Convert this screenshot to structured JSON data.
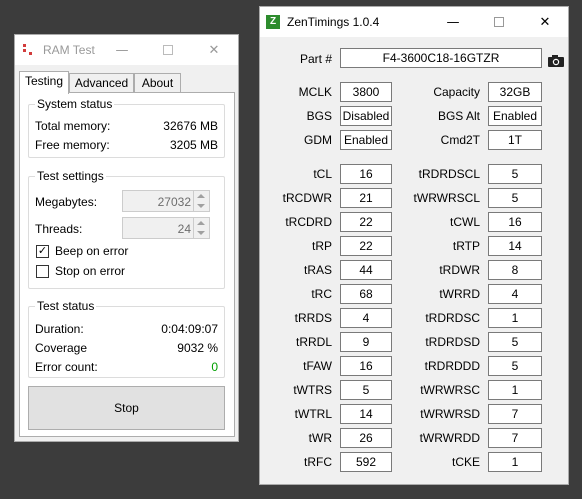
{
  "ramtest": {
    "title": "RAM Test",
    "tabs": [
      "Testing",
      "Advanced",
      "About"
    ],
    "system_status": {
      "label": "System status",
      "total_memory_label": "Total memory:",
      "total_memory_value": "32676 MB",
      "free_memory_label": "Free memory:",
      "free_memory_value": "3205 MB"
    },
    "test_settings": {
      "label": "Test settings",
      "megabytes_label": "Megabytes:",
      "megabytes_value": "27032",
      "threads_label": "Threads:",
      "threads_value": "24",
      "beep_label": "Beep on error",
      "beep_checked": true,
      "stop_label": "Stop on error",
      "stop_checked": false
    },
    "test_status": {
      "label": "Test status",
      "duration_label": "Duration:",
      "duration_value": "0:04:09:07",
      "coverage_label": "Coverage",
      "coverage_value": "9032 %",
      "errors_label": "Error count:",
      "errors_value": "0",
      "errors_color": "#00a000"
    },
    "stop_button": "Stop"
  },
  "zen": {
    "title": "ZenTimings 1.0.4",
    "icon_letter": "Z",
    "part_label": "Part #",
    "part_value": "F4-3600C18-16GTZR",
    "top": [
      {
        "l1": "MCLK",
        "v1": "3800",
        "l2": "Capacity",
        "v2": "32GB"
      },
      {
        "l1": "BGS",
        "v1": "Disabled",
        "l2": "BGS Alt",
        "v2": "Enabled"
      },
      {
        "l1": "GDM",
        "v1": "Enabled",
        "l2": "Cmd2T",
        "v2": "1T"
      }
    ],
    "timings": [
      {
        "l1": "tCL",
        "v1": "16",
        "l2": "tRDRDSCL",
        "v2": "5"
      },
      {
        "l1": "tRCDWR",
        "v1": "21",
        "l2": "tWRWRSCL",
        "v2": "5"
      },
      {
        "l1": "tRCDRD",
        "v1": "22",
        "l2": "tCWL",
        "v2": "16"
      },
      {
        "l1": "tRP",
        "v1": "22",
        "l2": "tRTP",
        "v2": "14"
      },
      {
        "l1": "tRAS",
        "v1": "44",
        "l2": "tRDWR",
        "v2": "8"
      },
      {
        "l1": "tRC",
        "v1": "68",
        "l2": "tWRRD",
        "v2": "4"
      },
      {
        "l1": "tRRDS",
        "v1": "4",
        "l2": "tRDRDSC",
        "v2": "1"
      },
      {
        "l1": "tRRDL",
        "v1": "9",
        "l2": "tRDRDSD",
        "v2": "5"
      },
      {
        "l1": "tFAW",
        "v1": "16",
        "l2": "tRDRDDD",
        "v2": "5"
      },
      {
        "l1": "tWTRS",
        "v1": "5",
        "l2": "tWRWRSC",
        "v2": "1"
      },
      {
        "l1": "tWTRL",
        "v1": "14",
        "l2": "tWRWRSD",
        "v2": "7"
      },
      {
        "l1": "tWR",
        "v1": "26",
        "l2": "tWRWRDD",
        "v2": "7"
      },
      {
        "l1": "tRFC",
        "v1": "592",
        "l2": "tCKE",
        "v2": "1"
      }
    ]
  },
  "icons": {
    "minimize": "minimize-icon",
    "maximize": "maximize-icon",
    "close": "close-icon",
    "camera": "camera-icon"
  }
}
